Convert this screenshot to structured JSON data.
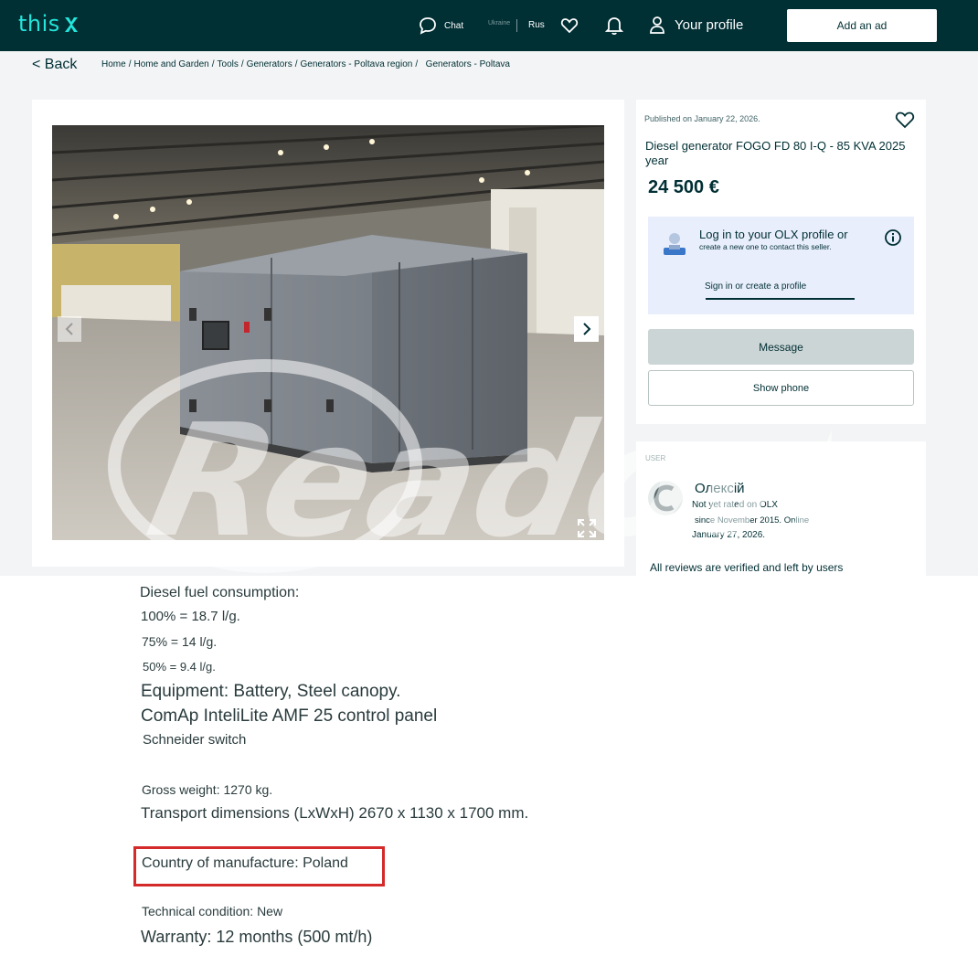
{
  "header": {
    "logo_text": "this",
    "chat_label": "Chat",
    "lang_ukraine": "Ukraine",
    "lang_rus": "Rus",
    "profile_label": "Your profile",
    "add_ad_label": "Add an ad",
    "colors": {
      "bar": "#002f34",
      "accent": "#23e5db"
    }
  },
  "nav": {
    "back_label": "< Back",
    "breadcrumbs": [
      "Home",
      "Home and Garden",
      "Tools",
      "Generators",
      "Generators - Poltava region",
      "Generators - Poltava"
    ]
  },
  "listing": {
    "published": "Published on January 22, 2026.",
    "title": "Diesel generator FOGO FD 80 I-Q - 85 KVA 2025 year",
    "price": "24 500 €",
    "login_title": "Log in to your OLX profile or",
    "login_sub": "create a new one to contact this seller.",
    "signin_label": "Sign in or create a profile",
    "message_label": "Message",
    "show_phone_label": "Show phone"
  },
  "seller": {
    "section_label": "USER",
    "name": "Олексій",
    "rated": "Not yet rated on OLX",
    "since": "since November 2015. Online",
    "online": "January 27, 2026.",
    "reviews_note": "All reviews are verified and left by users"
  },
  "description": {
    "fuel_heading": "Diesel fuel consumption:",
    "fuel_100": "100% = 18.7 l/g.",
    "fuel_75": "75% = 14 l/g.",
    "fuel_50": "50% = 9.4 l/g.",
    "equipment": "Equipment: Battery, Steel canopy.",
    "panel": "ComAp InteliLite AMF 25 control panel",
    "switch": "Schneider switch",
    "weight": "Gross weight: 1270 kg.",
    "dimensions": "Transport dimensions (LxWxH) 2670 x 1130 x 1700 mm.",
    "country": "Country of manufacture: Poland",
    "condition": "Technical condition: New",
    "warranty": "Warranty: 12 months (500 mt/h)"
  },
  "watermark_text": "Readovka",
  "icons": [
    "chat-icon",
    "heart-icon",
    "bell-icon",
    "user-icon",
    "chevron-left-icon",
    "chevron-right-icon",
    "expand-icon",
    "info-icon"
  ]
}
